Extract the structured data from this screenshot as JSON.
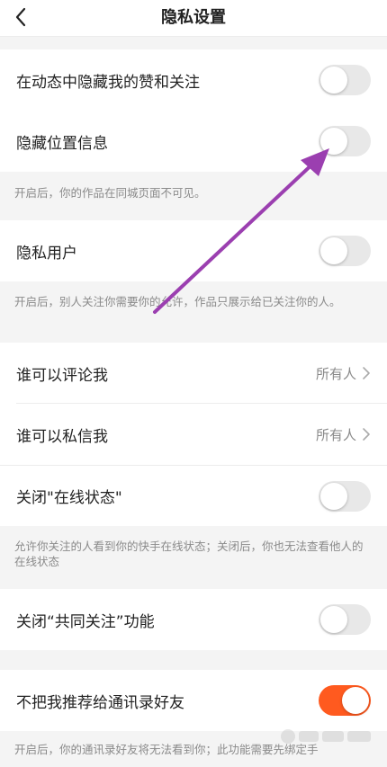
{
  "header": {
    "title": "隐私设置"
  },
  "rows": {
    "hide_likes": {
      "label": "在动态中隐藏我的赞和关注",
      "on": false
    },
    "hide_location": {
      "label": "隐藏位置信息",
      "on": false,
      "note": "开启后，你的作品在同城页面不可见。"
    },
    "private_user": {
      "label": "隐私用户",
      "on": false,
      "note": "开启后，别人关注你需要你的允许，作品只展示给已关注你的人。"
    },
    "who_comment": {
      "label": "谁可以评论我",
      "value": "所有人"
    },
    "who_message": {
      "label": "谁可以私信我",
      "value": "所有人"
    },
    "online_status": {
      "label": "关闭\"在线状态\"",
      "on": false,
      "note": "允许你关注的人看到你的快手在线状态；关闭后，你也无法查看他人的在线状态"
    },
    "mutual_follow": {
      "label": "关闭“共同关注”功能",
      "on": false
    },
    "contacts_recommend": {
      "label": "不把我推荐给通讯录好友",
      "on": true,
      "note": "开启后，你的通讯录好友将无法看到你；此功能需要先绑定手"
    }
  },
  "colors": {
    "accent_on": "#ff5a1f",
    "annotation_arrow": "#9b3fb0"
  },
  "icons": {
    "back": "chevron-left-icon",
    "row_chevron": "chevron-right-icon"
  }
}
